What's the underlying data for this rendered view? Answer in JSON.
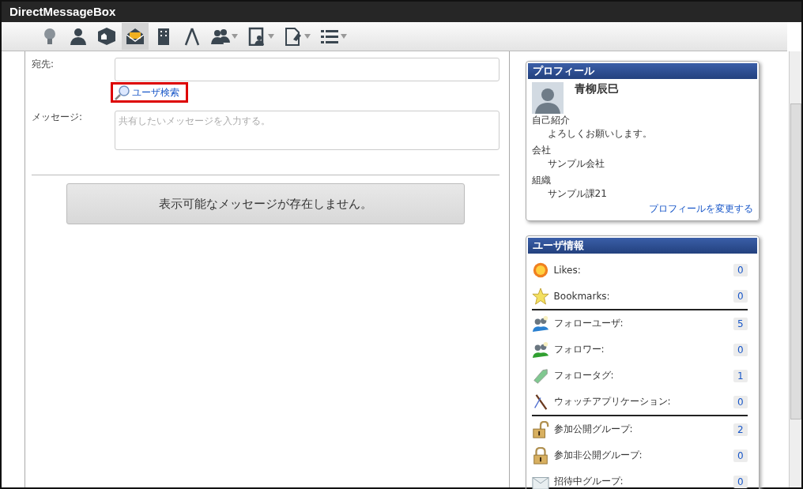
{
  "window": {
    "title": "DirectMessageBox"
  },
  "toolbar": [
    {
      "selected": false,
      "dropdown": false
    },
    {
      "selected": false,
      "dropdown": false
    },
    {
      "selected": false,
      "dropdown": false
    },
    {
      "selected": true,
      "dropdown": false
    },
    {
      "selected": false,
      "dropdown": false
    },
    {
      "selected": false,
      "dropdown": false
    },
    {
      "selected": false,
      "dropdown": true
    },
    {
      "selected": false,
      "dropdown": true
    },
    {
      "selected": false,
      "dropdown": true
    },
    {
      "selected": false,
      "dropdown": true
    }
  ],
  "form": {
    "to_label": "宛先:",
    "user_search": "ユーザ検索",
    "message_label": "メッセージ:",
    "message_placeholder": "共有したいメッセージを入力する。"
  },
  "empty_message": "表示可能なメッセージが存在しません。",
  "profile": {
    "title": "プロフィール",
    "name": "青柳辰巳",
    "fields": [
      {
        "label": "自己紹介",
        "value": "よろしくお願いします。"
      },
      {
        "label": "会社",
        "value": "サンプル会社"
      },
      {
        "label": "組織",
        "value": "サンプル課21"
      }
    ],
    "edit_link": "プロフィールを変更する"
  },
  "user_info": {
    "title": "ユーザ情報",
    "groups": [
      [
        {
          "label": "Likes:",
          "count": "0"
        },
        {
          "label": "Bookmarks:",
          "count": "0"
        }
      ],
      [
        {
          "label": "フォローユーザ:",
          "count": "5"
        },
        {
          "label": "フォロワー:",
          "count": "0"
        },
        {
          "label": "フォロータグ:",
          "count": "1"
        },
        {
          "label": "ウォッチアプリケーション:",
          "count": "0"
        }
      ],
      [
        {
          "label": "参加公開グループ:",
          "count": "2"
        },
        {
          "label": "参加非公開グループ:",
          "count": "0"
        },
        {
          "label": "招待中グループ:",
          "count": "0"
        }
      ]
    ]
  }
}
